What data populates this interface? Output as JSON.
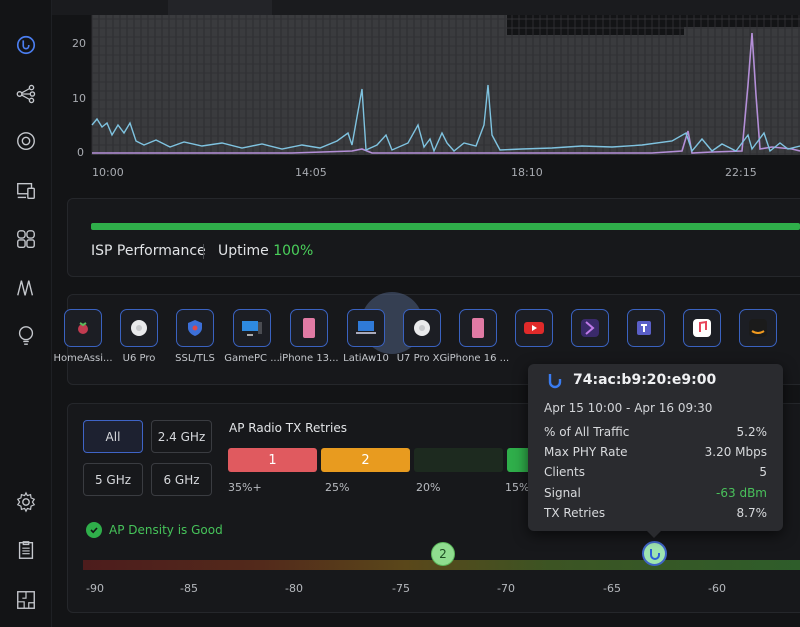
{
  "chart": {
    "y_ticks": [
      "20",
      "10",
      "0"
    ],
    "x_ticks": [
      "10:00",
      "14:05",
      "18:10",
      "22:15"
    ]
  },
  "isp": {
    "title": "ISP Performance",
    "uptime_label": "Uptime",
    "uptime_value": "100%"
  },
  "devices": [
    {
      "label": "HomeAssi...",
      "icon": "raspberry-pi-icon"
    },
    {
      "label": "U6 Pro",
      "icon": "access-point-icon"
    },
    {
      "label": "SSL/TLS",
      "icon": "shield-icon"
    },
    {
      "label": "GamePC ...",
      "icon": "desktop-icon"
    },
    {
      "label": "iPhone 13...",
      "icon": "phone-icon"
    },
    {
      "label": "LatiAw10",
      "icon": "laptop-icon"
    },
    {
      "label": "U7 Pro XG",
      "icon": "access-point-icon"
    },
    {
      "label": "iPhone 16 ...",
      "icon": "phone-icon"
    },
    {
      "label": "",
      "icon": "youtube-icon"
    },
    {
      "label": "",
      "icon": "app-icon"
    },
    {
      "label": "",
      "icon": "teams-icon"
    },
    {
      "label": "",
      "icon": "music-icon"
    },
    {
      "label": "",
      "icon": "amazon-icon"
    }
  ],
  "bands": {
    "all": "All",
    "b24": "2.4 GHz",
    "b5": "5 GHz",
    "b6": "6 GHz"
  },
  "retries": {
    "title": "AP Radio TX Retries",
    "segments": [
      {
        "value": "1",
        "label": "35%+",
        "color": "#e05a5f"
      },
      {
        "value": "2",
        "label": "25%",
        "color": "#e89b1f"
      },
      {
        "value": "",
        "label": "20%",
        "color": "#1d2a1f"
      },
      {
        "value": "",
        "label": "15%",
        "color": "#2fae4a"
      }
    ]
  },
  "density": {
    "text": "AP Density is Good"
  },
  "scale": {
    "labels": [
      "-90",
      "-85",
      "-80",
      "-75",
      "-70",
      "-65",
      "-60"
    ],
    "marker_value": "2"
  },
  "tooltip": {
    "title": "74:ac:b9:20:e9:00",
    "range": "Apr 15 10:00 - Apr 16 09:30",
    "rows": [
      {
        "label": "% of All Traffic",
        "value": "5.2%"
      },
      {
        "label": "Max PHY Rate",
        "value": "3.20 Mbps"
      },
      {
        "label": "Clients",
        "value": "5"
      },
      {
        "label": "Signal",
        "value": "-63 dBm"
      },
      {
        "label": "TX Retries",
        "value": "8.7%"
      }
    ]
  },
  "colors": {
    "accent": "#3f64c6",
    "good": "#2fae4a",
    "series_rx": "#7fc3e0",
    "series_tx": "#b48fd8"
  }
}
